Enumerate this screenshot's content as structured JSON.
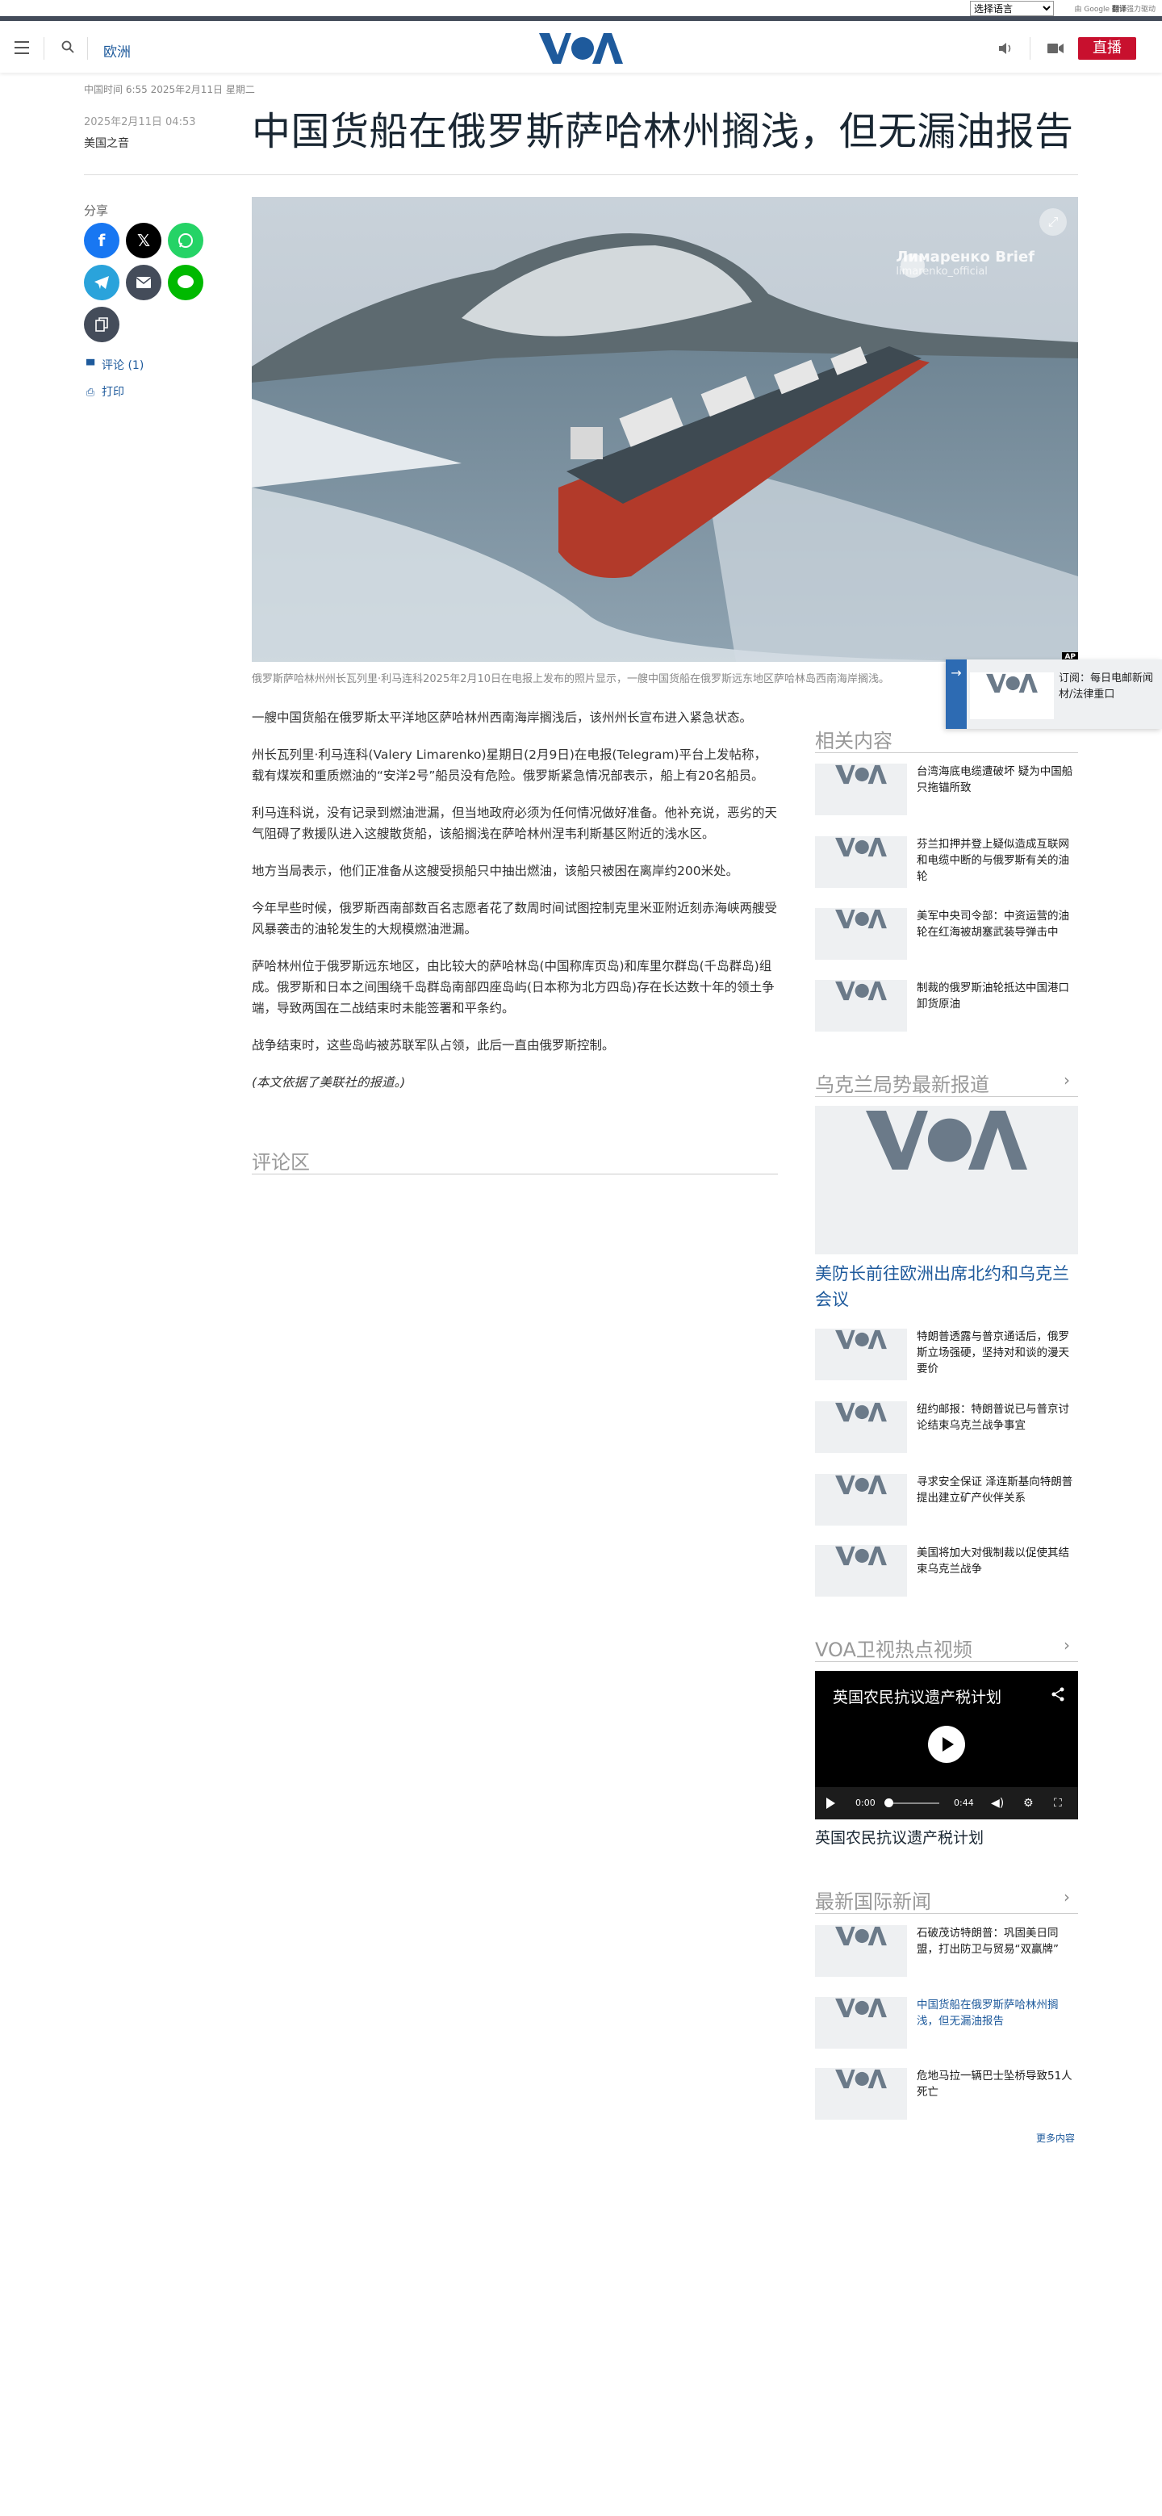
{
  "language_bar": {
    "select_value": "选择语言",
    "powered_prefix": "由",
    "powered_brand": "Google",
    "powered_translate": "翻译",
    "powered_suffix": "强力驱动"
  },
  "header": {
    "section": "欧洲",
    "live_label": "直播",
    "icons": [
      "menu-icon",
      "search-icon",
      "voa-logo",
      "speaker-icon",
      "video-camera-icon"
    ]
  },
  "article": {
    "timeline": "中国时间 6:55 2025年2月11日 星期二",
    "pub_date": "2025年2月11日 04:53",
    "source": "美国之音",
    "title": "中国货船在俄罗斯萨哈林州搁浅，但无漏油报告",
    "share_label": "分享",
    "comments_link": "评论 (1)",
    "print_link": "打印",
    "photo_watermark_name": "Лимаренко Brief",
    "photo_watermark_handle": "limarenko_official",
    "photo_credit": "AP",
    "caption": "俄罗斯萨哈林州州长瓦列里·利马连科2025年2月10日在电报上发布的照片显示，一艘中国货船在俄罗斯远东地区萨哈林岛西南海岸搁浅。",
    "paragraphs": [
      "一艘中国货船在俄罗斯太平洋地区萨哈林州西南海岸搁浅后，该州州长宣布进入紧急状态。",
      "州长瓦列里·利马连科(Valery Limarenko)星期日(2月9日)在电报(Telegram)平台上发帖称，载有煤炭和重质燃油的“安洋2号”船员没有危险。俄罗斯紧急情况部表示，船上有20名船员。",
      "利马连科说，没有记录到燃油泄漏，但当地政府必须为任何情况做好准备。他补充说，恶劣的天气阻碍了救援队进入这艘散货船，该船搁浅在萨哈林州涅韦利斯基区附近的浅水区。",
      "地方当局表示，他们正准备从这艘受损船只中抽出燃油，该船只被困在离岸约200米处。",
      "今年早些时候，俄罗斯西南部数百名志愿者花了数周时间试图控制克里米亚附近刻赤海峡两艘受风暴袭击的油轮发生的大规模燃油泄漏。",
      "萨哈林州位于俄罗斯远东地区，由比较大的萨哈林岛(中国称库页岛)和库里尔群岛(千岛群岛)组成。俄罗斯和日本之间围绕千岛群岛南部四座岛屿(日本称为北方四岛)存在长达数十年的领土争端，导致两国在二战结束时未能签署和平条约。",
      "战争结束时，这些岛屿被苏联军队占领，此后一直由俄罗斯控制。"
    ],
    "note": "(本文依据了美联社的报道。)",
    "comments_title": "评论区"
  },
  "sidebar": {
    "related": {
      "title": "相关内容",
      "items": [
        "台湾海底电缆遭破坏 疑为中国船只拖锚所致",
        "芬兰扣押并登上疑似造成互联网和电缆中断的与俄罗斯有关的油轮",
        "美军中央司令部：中资运营的油轮在红海被胡塞武装导弹击中",
        "制裁的俄罗斯油轮抵达中国港口卸货原油"
      ]
    },
    "ukraine": {
      "title": "乌克兰局势最新报道",
      "feature_title": "美防长前往欧洲出席北约和乌克兰会议",
      "items": [
        "特朗普透露与普京通话后，俄罗斯立场强硬，坚持对和谈的漫天要价",
        "纽约邮报：特朗普说已与普京讨论结束乌克兰战争事宜",
        "寻求安全保证 泽连斯基向特朗普提出建立矿产伙伴关系",
        "美国将加大对俄制裁以促使其结束乌克兰战争"
      ]
    },
    "video": {
      "title": "VOA卫视热点视频",
      "video_title": "英国农民抗议遗产税计划",
      "time_current": "0:00",
      "time_total": "0:44",
      "progress": 0,
      "caption": "英国农民抗议遗产税计划"
    },
    "world": {
      "title": "最新国际新闻",
      "items": [
        "石破茂访特朗普：巩固美日同盟，打出防卫与贸易“双赢牌”",
        "中国货船在俄罗斯萨哈林州搁浅，但无漏油报告",
        "危地马拉一辆巴士坠桥导致51人死亡"
      ],
      "more": "更多内容"
    }
  },
  "floating_panel": {
    "text": "订阅：每日电邮新闻材/法律重口"
  },
  "colors": {
    "brand_blue": "#1e5a9c",
    "live_red": "#c8102e",
    "facebook": "#1877f2",
    "x": "#000000",
    "whatsapp": "#25d366",
    "telegram": "#2aa3db",
    "email": "#444c5a",
    "line": "#00b900"
  }
}
